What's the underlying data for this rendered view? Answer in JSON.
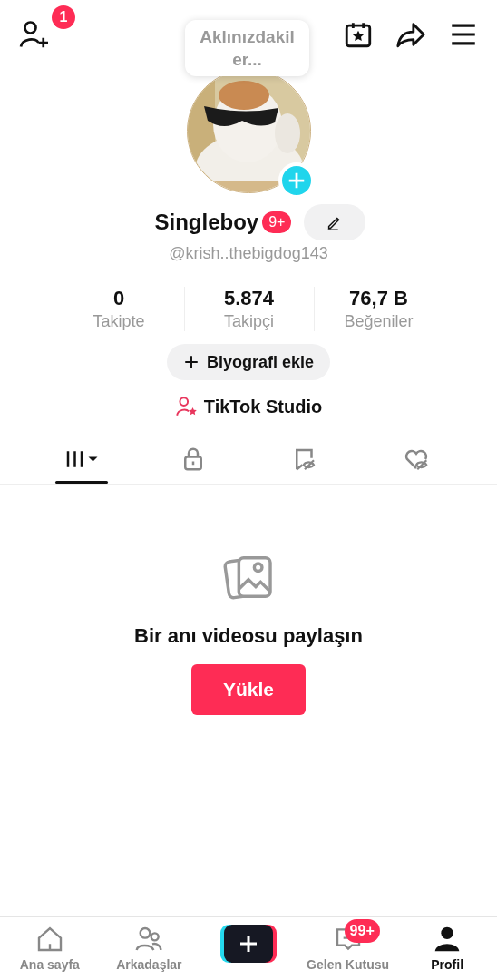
{
  "top_bar": {
    "friends_badge": "1"
  },
  "note_bubble": {
    "lines": [
      "Aklınızdakil",
      "er..."
    ]
  },
  "profile": {
    "name": "Singleboy",
    "name_badge": "9+",
    "handle": "@krish..thebigdog143"
  },
  "stats": [
    {
      "value": "0",
      "label": "Takipte"
    },
    {
      "value": "5.874",
      "label": "Takipçi"
    },
    {
      "value": "76,7 B",
      "label": "Beğeniler"
    }
  ],
  "bio_button": "Biyografi ekle",
  "studio_link": "TikTok Studio",
  "tabs": [
    {
      "kind": "videos",
      "selected": true
    },
    {
      "kind": "private",
      "selected": false
    },
    {
      "kind": "reposts",
      "selected": false
    },
    {
      "kind": "liked",
      "selected": false
    }
  ],
  "empty_state": {
    "title": "Bir anı videosu paylaşın",
    "button": "Yükle"
  },
  "bottom_nav": [
    {
      "kind": "home",
      "label": "Ana sayfa",
      "selected": false
    },
    {
      "kind": "friends",
      "label": "Arkadaşlar",
      "selected": false
    },
    {
      "kind": "create",
      "selected": false
    },
    {
      "kind": "inbox",
      "label": "Gelen Kutusu",
      "badge": "99+",
      "selected": false
    },
    {
      "kind": "profile",
      "label": "Profil",
      "selected": true
    }
  ]
}
